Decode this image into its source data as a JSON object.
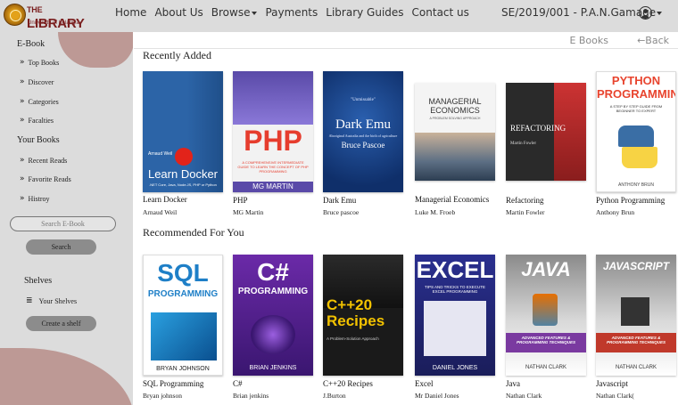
{
  "logo": {
    "the": "THE",
    "name": "LIBRARY",
    "subtitle": "University of Kelaniya"
  },
  "nav": {
    "home": "Home",
    "about": "About Us",
    "browse": "Browse",
    "payments": "Payments",
    "guides": "Library Guides",
    "contact": "Contact us"
  },
  "user": {
    "id": "SE/2019/001 - P.A.N.Gamage"
  },
  "sidebar": {
    "ebook_heading": "E-Book",
    "ebook_items": [
      "Top Books",
      "Discover",
      "Categories",
      "Facalties"
    ],
    "your_books_heading": "Your Books",
    "your_books_items": [
      "Recent Reads",
      "Favorite Reads",
      "Histroy"
    ],
    "search_placeholder": "Search E-Book",
    "search_button": "Search",
    "shelves_heading": "Shelves",
    "your_shelves": "Your Shelves",
    "create_shelf": "Create a shelf"
  },
  "breadcrumb": {
    "current": "E Books",
    "back": "Back"
  },
  "recently_added": {
    "heading": "Recently Added",
    "books": [
      {
        "title": "Learn Docker",
        "author": "Arnaud Weil",
        "cover_top": "Arnaud Weil",
        "cover_title": "Learn Docker",
        "cover_sub": ".NET Core, Java, Node.JS, PHP or Python"
      },
      {
        "title": "PHP",
        "author": "MG Martin",
        "cover_title": "PHP",
        "cover_sub": "A COMPREHENSIVE INTERMEDIATE GUIDE TO LEARN THE CONCEPT OF PHP PROGRAMMING",
        "cover_author": "MG MARTIN"
      },
      {
        "title": "Dark Emu",
        "author": "Bruce pascoe",
        "cover_top": "\"Unmissable\"",
        "cover_title": "Dark Emu",
        "cover_sub": "Aboriginal Australia and the birth of agriculture",
        "cover_author": "Bruce Pascoe"
      },
      {
        "title": "Managerial Economics",
        "author": "Luke M. Froeb",
        "cover_title": "MANAGERIAL ECONOMICS",
        "cover_sub": "A PROBLEM SOLVING APPROACH"
      },
      {
        "title": "Refactoring",
        "author": "Martin Fowler",
        "cover_title": "REFACTORING",
        "cover_author": "Martin Fowler"
      },
      {
        "title": "Python Programming",
        "author": "Anthony Brun",
        "cover_title": "PYTHON PROGRAMMING",
        "cover_sub": "A STEP BY STEP GUIDE FROM BEGINNER TO EXPERT",
        "cover_author": "ANTHONY BRUN"
      }
    ]
  },
  "recommended": {
    "heading": "Recommended For You",
    "books": [
      {
        "title": "SQL Programming",
        "author": "Bryan johnson",
        "cover_title": "SQL",
        "cover_sub": "PROGRAMMING",
        "cover_author": "BRYAN JOHNSON"
      },
      {
        "title": "C#",
        "author": "Brian jenkins",
        "cover_title": "C#",
        "cover_sub": "PROGRAMMING",
        "cover_author": "BRIAN JENKINS"
      },
      {
        "title": "C++20 Recipes",
        "author": "J.Burton",
        "cover_title": "C++20 Recipes",
        "cover_sub": "A Problem-Solution Approach"
      },
      {
        "title": "Excel",
        "author": "Mr Daniel Jones",
        "cover_title": "EXCEL",
        "cover_sub": "TIPS AND TRICKS TO EXECUTE EXCEL PROGRAMMING",
        "cover_author": "DANIEL JONES"
      },
      {
        "title": "Java",
        "author": "Nathan Clark",
        "cover_title": "JAVA",
        "cover_sub": "ADVANCED FEATURES & PROGRAMMING TECHNIQUES",
        "cover_author": "NATHAN CLARK"
      },
      {
        "title": "Javascript",
        "author": "Nathan Clark(",
        "cover_title": "JAVASCRIPT",
        "cover_sub": "ADVANCED FEATURES & PROGRAMMING TECHNIQUES",
        "cover_author": "NATHAN CLARK"
      }
    ]
  }
}
